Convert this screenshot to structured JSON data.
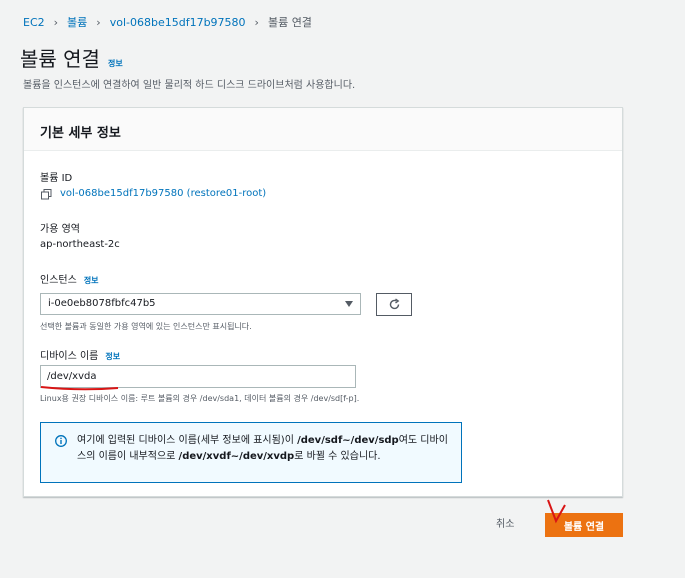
{
  "breadcrumb": {
    "items": [
      "EC2",
      "볼륨",
      "vol-068be15df17b97580"
    ],
    "current": "볼륨 연결"
  },
  "page": {
    "title": "볼륨 연결",
    "info": "정보",
    "description": "볼륨을 인스턴스에 연결하여 일반 물리적 하드 디스크 드라이브처럼 사용합니다."
  },
  "panel": {
    "title": "기본 세부 정보",
    "volume_id_label": "볼륨 ID",
    "volume_id_value": "vol-068be15df17b97580 (restore01-root)",
    "az_label": "가용 영역",
    "az_value": "ap-northeast-2c",
    "instance_label": "인스턴스",
    "instance_info": "정보",
    "instance_value": "i-0e0eb8078fbfc47b5",
    "instance_hint": "선택한 볼륨과 동일한 가용 영역에 있는 인스턴스만 표시됩니다.",
    "device_label": "디바이스 이름",
    "device_info": "정보",
    "device_value": "/dev/xvda",
    "device_hint": "Linux용 권장 디바이스 이름: 루트 볼륨의 경우 /dev/sda1, 데이터 볼륨의 경우 /dev/sd[f-p]."
  },
  "alert": {
    "text_1": "여기에 입력된 디바이스 이름(세부 정보에 표시됨)이 ",
    "bold_1": "/dev/sdf~/dev/sdp",
    "text_2": "여도 디바이스의 이름이 내부적으로 ",
    "bold_2": "/dev/xvdf~/dev/xvdp",
    "text_3": "로 바뀔 수 있습니다."
  },
  "footer": {
    "cancel": "취소",
    "submit": "볼륨 연결"
  },
  "colors": {
    "link": "#0073bb",
    "primary": "#ec7211",
    "annotation": "#d91515"
  }
}
